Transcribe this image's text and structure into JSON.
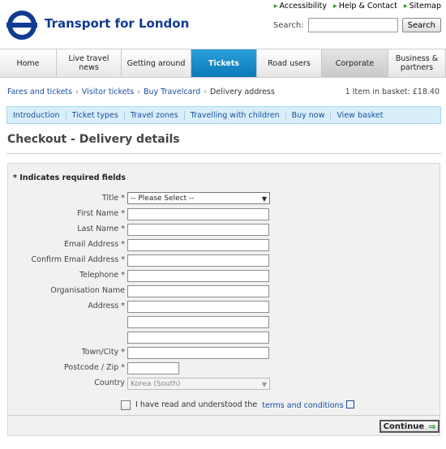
{
  "header": {
    "brand": "Transport for London",
    "top_links": [
      "Accessibility",
      "Help & Contact",
      "Sitemap"
    ],
    "search_label": "Search:",
    "search_value": "",
    "search_button": "Search"
  },
  "nav": {
    "tabs": [
      "Home",
      "Live travel news",
      "Getting around",
      "Tickets",
      "Road users",
      "Corporate",
      "Business & partners"
    ],
    "active": "Tickets"
  },
  "breadcrumb": [
    "Fares and tickets",
    "Visitor tickets",
    "Buy Travelcard",
    "Delivery address"
  ],
  "basket": "1 Item in basket:  £18.40",
  "subnav": [
    "Introduction",
    "Ticket types",
    "Travel zones",
    "Travelling with children",
    "Buy now",
    "View basket"
  ],
  "page_title": "Checkout - Delivery details",
  "form": {
    "required_note": "* Indicates required fields",
    "labels": {
      "title": "Title *",
      "first_name": "First Name *",
      "last_name": "Last Name *",
      "email": "Email Address *",
      "confirm_email": "Confirm Email Address *",
      "telephone": "Telephone *",
      "organisation": "Organisation Name",
      "address": "Address *",
      "town": "Town/City *",
      "postcode": "Postcode / Zip *",
      "country": "Country"
    },
    "title_value": "-- Please Select --",
    "country_value": "Korea (South)",
    "terms_text": "I have read and understood the",
    "terms_link": "terms and conditions",
    "continue_label": "Continue"
  },
  "colors": {
    "accent_blue": "#0b78b8",
    "brand_blue": "#113b92",
    "arrow_green": "#1e9a28"
  }
}
